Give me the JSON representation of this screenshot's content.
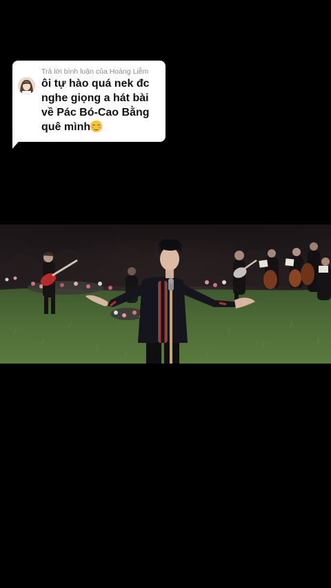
{
  "reply_sticker": {
    "header": "Trả lời bình luận của Hoàng Liễm",
    "comment_line1": "ôi tự hào quá nek đc",
    "comment_line2": "nghe giọng a hát bài",
    "comment_line3": "về Pác Bó-Cao Bằng",
    "comment_line4": "quê mình",
    "emoji_icon": "relieved-face-emoji"
  },
  "video": {
    "scene": "singer-with-microphone-and-orchestra-outdoors"
  },
  "colors": {
    "background": "#000000",
    "sticker_bg": "#ffffff",
    "header_text": "#8a8a8a",
    "comment_text": "#111111"
  }
}
